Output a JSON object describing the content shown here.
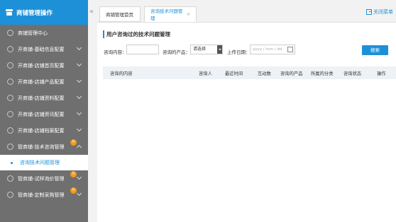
{
  "sidebar": {
    "title": "商铺管理操作",
    "center": "商铺管理中心",
    "items": [
      {
        "label": "开商铺-基础信息配置"
      },
      {
        "label": "开商铺-店铺首页配置"
      },
      {
        "label": "开商铺-店铺产品配置"
      },
      {
        "label": "开商铺-店铺资料配置"
      },
      {
        "label": "开商铺-店铺资讯配置"
      },
      {
        "label": "开商铺-店铺档案配置"
      },
      {
        "label": "管商铺-技术咨询管理",
        "badge": "0"
      },
      {
        "label": "管商铺-试样询价管理",
        "badge": "0"
      },
      {
        "label": "管商铺-定制采购管理",
        "badge": "0"
      }
    ],
    "active_sub": "咨询技术问题管理"
  },
  "collapse_glyph": "«",
  "tabs": [
    {
      "label": "商铺管理首页"
    },
    {
      "label": "咨询技术问题管理",
      "close": "×"
    }
  ],
  "close_menu": "关闭菜单",
  "main": {
    "title": "用户咨询过的技术问题管理",
    "filters": {
      "content_label": "咨询内容：",
      "product_label": "咨询的产品：",
      "product_value": "请选择",
      "date_label": "上传日期：",
      "date_placeholder": "yyyy / mm / dd"
    },
    "search_button": "搜索",
    "columns": [
      "咨询的内容",
      "咨询人",
      "最近时间",
      "互动数",
      "咨询的产品",
      "所属的分类",
      "咨询状态",
      "操作"
    ]
  },
  "colors": {
    "accent": "#1e90d8",
    "sidebar_bg": "#6f6f6f",
    "badge": "#f39c12"
  }
}
